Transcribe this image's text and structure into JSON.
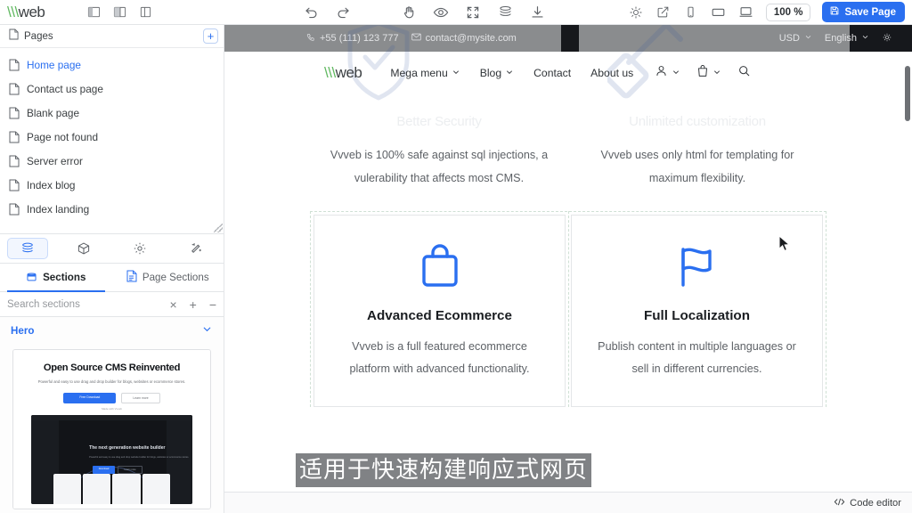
{
  "toolbar": {
    "logo_v": "\\\\\\",
    "logo_text": "web",
    "layout_icons": [
      "panel-left-icon",
      "panel-split-icon",
      "panel-right-icon"
    ],
    "undo_label": "undo-icon",
    "redo_label": "redo-icon",
    "hand_label": "hand-icon",
    "preview_label": "eye-icon",
    "fullscreen_label": "fullscreen-icon",
    "layers_label": "layers-icon",
    "download_label": "download-icon",
    "theme_label": "sun-icon",
    "external_label": "external-link-icon",
    "mobile_label": "mobile-icon",
    "tablet_label": "tablet-icon",
    "desktop_label": "desktop-icon",
    "zoom_value": "100 %",
    "save_label": "Save Page"
  },
  "sidebar": {
    "pages_header": "Pages",
    "add_page_label": "+",
    "pages": [
      {
        "label": "Home page",
        "active": true
      },
      {
        "label": "Contact us page",
        "active": false
      },
      {
        "label": "Blank page",
        "active": false
      },
      {
        "label": "Page not found",
        "active": false
      },
      {
        "label": "Server error",
        "active": false
      },
      {
        "label": "Index blog",
        "active": false
      },
      {
        "label": "Index landing",
        "active": false
      }
    ],
    "panel_tabs": [
      {
        "name": "sections-tab",
        "icon": "layers-icon",
        "active": true
      },
      {
        "name": "components-tab",
        "icon": "cube-icon",
        "active": false
      },
      {
        "name": "settings-tab",
        "icon": "gear-icon",
        "active": false
      },
      {
        "name": "ai-tab",
        "icon": "magic-wand-icon",
        "active": false
      }
    ],
    "section_tabs": [
      {
        "label": "Sections",
        "icon": "box-icon",
        "active": true
      },
      {
        "label": "Page Sections",
        "icon": "document-icon",
        "active": false
      }
    ],
    "search_placeholder": "Search sections",
    "search_value": "",
    "search_clear": "×",
    "search_add": "+",
    "search_remove": "−",
    "accordion": {
      "label": "Hero",
      "expanded": true
    },
    "thumbnail": {
      "title": "Open Source CMS Reinvented",
      "subtitle": "Powerful and easy to use drag and drop builder for blogs, websites or ecommerce stores.",
      "primary_button": "Free Download",
      "secondary_button": "Learn more",
      "note": "Made with Vvveb",
      "inner_hero_title": "The next generation website builder",
      "inner_hero_sub": "Powerful and easy to use drag and drop website builder for blogs, websites or ecommerce stores.",
      "inner_btn1": "Download",
      "inner_btn2": "Learn more"
    }
  },
  "canvas": {
    "site_topbar": {
      "phone_icon": "phone-icon",
      "phone": "+55 (111) 123 777",
      "email_icon": "mail-icon",
      "email": "contact@mysite.com",
      "currency": "USD",
      "language": "English",
      "theme_icon": "sun-icon"
    },
    "site_nav": {
      "logo_v": "\\\\\\",
      "logo_text": "web",
      "links": [
        {
          "label": "Mega menu",
          "caret": true
        },
        {
          "label": "Blog",
          "caret": true
        },
        {
          "label": "Contact",
          "caret": false
        },
        {
          "label": "About us",
          "caret": false
        }
      ],
      "account_icon": "user-icon",
      "cart_icon": "bag-icon",
      "search_icon": "search-icon"
    },
    "watermarks": [
      {
        "name": "shield-check-icon"
      },
      {
        "name": "paint-roller-icon"
      }
    ],
    "faded_titles": [
      "Better Security",
      "Unlimited customization"
    ],
    "feature_row_top": [
      {
        "text": "Vvveb is 100% safe against sql injections, a vulerability that affects most CMS."
      },
      {
        "text": "Vvveb uses only html for templating for maximum flexibility."
      }
    ],
    "feature_row_bottom": [
      {
        "icon": "shopping-bag-icon",
        "title": "Advanced Ecommerce",
        "text": "Vvveb is a full featured ecommerce platform with advanced functionality."
      },
      {
        "icon": "flag-icon",
        "title": "Full Localization",
        "text": "Publish content in multiple languages or sell in different currencies."
      }
    ]
  },
  "caption": {
    "text": "适用于快速构建响应式网页"
  },
  "statusbar": {
    "code_editor_label": "Code editor",
    "code_icon": "code-icon"
  },
  "colors": {
    "accent": "#2a6ff0",
    "logo_green": "#60b860",
    "caption_bg": "#808285",
    "dark_topbar": "#16181c",
    "band_gray": "#8a8c8e"
  }
}
